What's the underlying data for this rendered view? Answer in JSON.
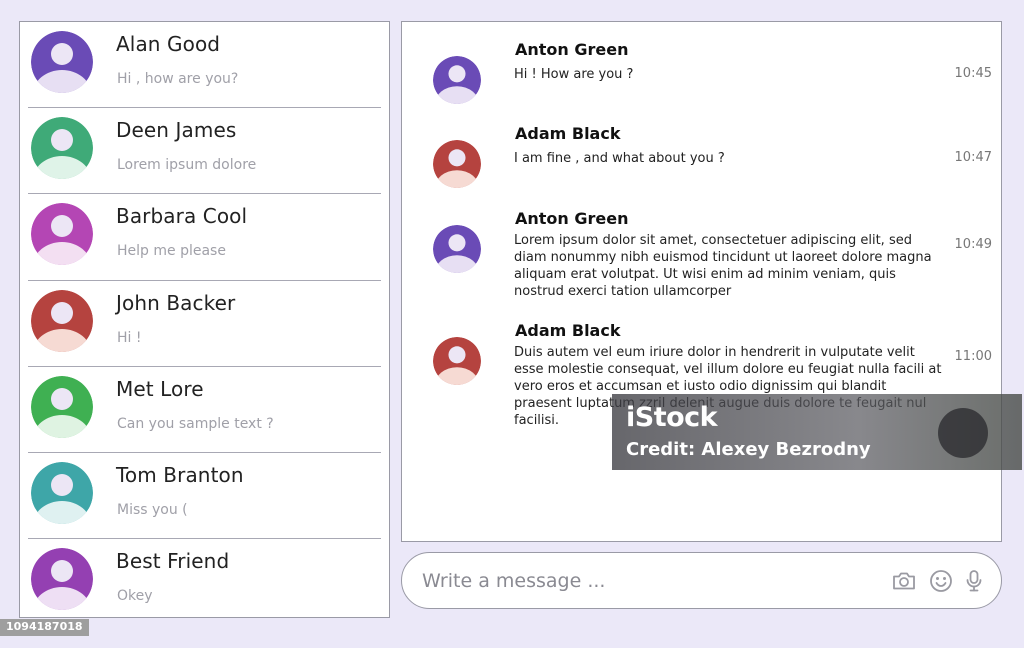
{
  "colors": {
    "background": "#ebe8f8",
    "avatar_head": "#ece6f5"
  },
  "contacts": [
    {
      "name": "Alan Good",
      "preview": "Hi , how are you?",
      "avatar_color": "#6a4bb6",
      "avatar_body": "#e7dff3"
    },
    {
      "name": "Deen James",
      "preview": "Lorem ipsum dolore",
      "avatar_color": "#3faa78",
      "avatar_body": "#dff3e8"
    },
    {
      "name": "Barbara Cool",
      "preview": "Help me please",
      "avatar_color": "#b446b4",
      "avatar_body": "#f3dff2"
    },
    {
      "name": "John Backer",
      "preview": "Hi !",
      "avatar_color": "#b5433f",
      "avatar_body": "#f6dad3"
    },
    {
      "name": "Met Lore",
      "preview": "Can you sample text ?",
      "avatar_color": "#3fb052",
      "avatar_body": "#dff3e2"
    },
    {
      "name": "Tom Branton",
      "preview": "Miss you (",
      "avatar_color": "#3ea6a8",
      "avatar_body": "#dff1f1"
    },
    {
      "name": "Best Friend",
      "preview": "Okey",
      "avatar_color": "#9440b2",
      "avatar_body": "#eedff4"
    }
  ],
  "messages": [
    {
      "sender": "Anton Green",
      "text": "Hi ! How are you ?",
      "time": "10:45",
      "avatar_color": "#6a4bb6",
      "avatar_body": "#e7dff3"
    },
    {
      "sender": "Adam Black",
      "text": "I am fine , and what about you ?",
      "time": "10:47",
      "avatar_color": "#b5433f",
      "avatar_body": "#f6dad3"
    },
    {
      "sender": "Anton Green",
      "text": "Lorem ipsum dolor sit amet, consectetuer adipiscing elit, sed diam nonummy nibh euismod tincidunt ut laoreet dolore magna aliquam erat volutpat. Ut wisi enim ad minim veniam, quis nostrud exerci tation ullamcorper",
      "time": "10:49",
      "avatar_color": "#6a4bb6",
      "avatar_body": "#e7dff3"
    },
    {
      "sender": "Adam Black",
      "text": "Duis autem vel eum iriure dolor in hendrerit in vulputate velit esse molestie consequat, vel illum dolore eu feugiat nulla facili at vero eros et accumsan et iusto odio dignissim qui blandit praesent luptatum zzril delenit augue duis dolore te feugait nul facilisi.",
      "time": "11:00",
      "avatar_color": "#b5433f",
      "avatar_body": "#f6dad3"
    }
  ],
  "composer": {
    "placeholder": "Write a message ...",
    "icons": [
      "camera-icon",
      "emoji-icon",
      "microphone-icon"
    ]
  },
  "watermark": {
    "logo": "iStock",
    "credit": "Credit: Alexey Bezrodny"
  },
  "image_id": "1094187018"
}
